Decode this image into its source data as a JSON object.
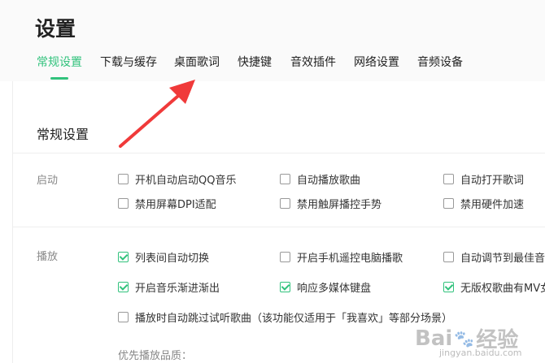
{
  "page": {
    "title": "设置"
  },
  "tabs": [
    {
      "label": "常规设置",
      "active": true
    },
    {
      "label": "下载与缓存",
      "active": false
    },
    {
      "label": "桌面歌词",
      "active": false
    },
    {
      "label": "快捷键",
      "active": false
    },
    {
      "label": "音效插件",
      "active": false
    },
    {
      "label": "网络设置",
      "active": false
    },
    {
      "label": "音频设备",
      "active": false
    }
  ],
  "section": {
    "title": "常规设置"
  },
  "startup": {
    "label": "启动",
    "options": [
      {
        "label": "开机自动启动QQ音乐",
        "checked": false
      },
      {
        "label": "自动播放歌曲",
        "checked": false
      },
      {
        "label": "自动打开歌词",
        "checked": false
      },
      {
        "label": "禁用屏幕DPI适配",
        "checked": false
      },
      {
        "label": "禁用触屏播控手势",
        "checked": false
      },
      {
        "label": "禁用硬件加速",
        "checked": false
      }
    ]
  },
  "playback": {
    "label": "播放",
    "options": [
      {
        "label": "列表间自动切换",
        "checked": true
      },
      {
        "label": "开启手机遥控电脑播歌",
        "checked": false
      },
      {
        "label": "自动调节到最佳音",
        "checked": false
      },
      {
        "label": "开启音乐渐进渐出",
        "checked": true
      },
      {
        "label": "响应多媒体键盘",
        "checked": true
      },
      {
        "label": "无版权歌曲有MV女",
        "checked": true
      },
      {
        "label": "播放时自动跳过试听歌曲（该功能仅适用于「我喜欢」等部分场景）",
        "checked": false
      }
    ],
    "quality_label": "优先播放品质："
  },
  "watermark": {
    "text_left": "Bai",
    "text_right": "经验",
    "sub": "jingyan.baidu.com"
  },
  "colors": {
    "accent": "#31c27c",
    "arrow": "#f03a3a"
  }
}
